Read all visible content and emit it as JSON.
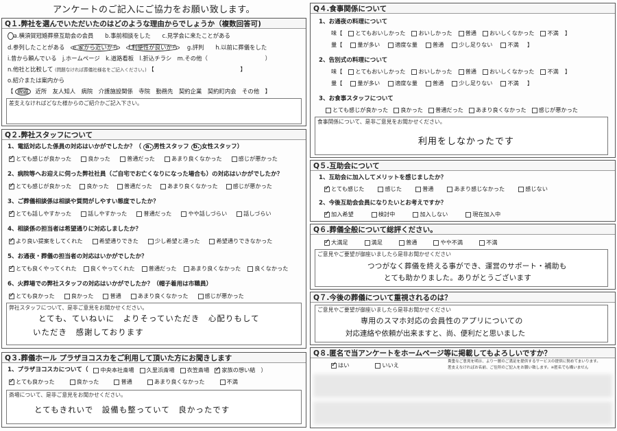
{
  "title": "アンケートのご記入にご協力をお願い致します。",
  "q1": {
    "head": "Q１.弊社を選んでいただいたのはどのような理由からでしょうか（複数回答可)",
    "row1": "a.横須賀冠婚葬祭互助会の会員　　b.事前相談をした　　c.見学会に来たことがある",
    "row2_a": "d.参列したことがある",
    "row2_e": "e.家から近いから",
    "row2_f": "f.利便性が良いから",
    "row2_rest": "g.評判　　h.以前に葬儀をした",
    "row3": "i.昔から頼んでいる　j.ホームページ　k.道路看板　l.折込チラシ　m.その他（　　　　　　　　　　）",
    "row4": "n.他社と比較して",
    "row4_small": "(問題なければ葬儀社様名をご記入ください。)",
    "row4_end": "【　　　　　　　　　　　　　　　】",
    "row5": "o.紹介または案内から",
    "row6_open": "【",
    "row6_circ": "親戚",
    "row6_rest": "近所　友人知人　病院　介護施設関係　寺院　勤務先　契約企業　契約町内会　その他　】",
    "box_label": "差支えなければどなた様からのご紹介かご記入下さい。"
  },
  "q2": {
    "head": "Q２.弊社スタッフについて",
    "sub1": "1、電話対応した係員の対応はいかがでしたか？（",
    "sub1_a": "a.",
    "sub1_a_text": "男性スタッフ",
    "sub1_b": "b.",
    "sub1_b_text": "女性スタッフ）",
    "opts1": [
      "とても感じが良かった",
      "良かった",
      "普通だった",
      "あまり良くなかった",
      "感じが悪かった"
    ],
    "sub2": "2、病院等へお迎えに伺った弊社社員（ご自宅でお亡くなりになった場合も）の対応はいかがでしたか？",
    "opts2": [
      "とても感じが良かった",
      "良かった",
      "普通だった",
      "あまり良くなかった",
      "感じが悪かった"
    ],
    "sub3": "3、ご葬儀相談係は相談や質問がしやすい態度でしたか？",
    "opts3": [
      "とても話しやすかった",
      "話しやすかった",
      "普通だった",
      "やや話しづらい",
      "話しづらい"
    ],
    "sub4": "4、相談係の担当者は希望通りに対応しましたか？",
    "opts4": [
      "より良い提案をしてくれた",
      "希望通りできた",
      "少し希望と違った",
      "希望通りできなかった"
    ],
    "sub5": "5、お通夜・葬儀の担当者の対応はいかがでしたか？",
    "opts5": [
      "とても良くやってくれた",
      "良くやってくれた",
      "普通だった",
      "あまり良くなかった",
      "良くなかった"
    ],
    "sub6": "6、火葬場での弊社スタッフの対応はいかがでしたか？（帽子着用は市職員）",
    "opts6": [
      "とても良かった",
      "良かった",
      "普通",
      "あまり良くなかった",
      "感じが悪かった"
    ],
    "box_label": "弊社スタッフについて、是非ご意見をお聞かせください。",
    "hw1": "とても、ていねいに　よりそっていただき　心配りもして",
    "hw2": "いただき　感謝しております"
  },
  "q3": {
    "head": "Q３.葬儀ホール プラザヨコスカをご利用して頂いた方にお聞きします",
    "sub1": "1、プラザヨコスカについて（",
    "halls": [
      "中央本社斎場",
      "久里浜斎場",
      "衣笠斎場",
      "家族の想い結"
    ],
    "hall_end": "）",
    "opts": [
      "とても良かった",
      "良かった",
      "普通",
      "あまり良くなかった",
      "不満"
    ],
    "box_label": "斎場について、是非ご意見をお聞かせください。",
    "hw": "とてもきれいで　設備も整っていて　良かったです"
  },
  "q4": {
    "head": "Q４.食事関係について",
    "sub1": "1、お通夜の料理について",
    "taste_label": "味【",
    "taste_opts": [
      "とてもおいしかった",
      "おいしかった",
      "普通",
      "おいしくなかった",
      "不満"
    ],
    "taste_end": "】",
    "qty_label": "量【",
    "qty_opts": [
      "量が多い",
      "適度な量",
      "普通",
      "少し足りない",
      "不満"
    ],
    "qty_end": "】",
    "sub2": "2、告別式の料理について",
    "sub3": "3、お食事スタッフについて",
    "staff_opts": [
      "とても感じが良かった",
      "良かった",
      "普通だった",
      "あまり良くなかった",
      "感じが悪かった"
    ],
    "box_label": "食事関係について、是非ご意見をお聞かせください。",
    "hw": "利用をしなかったです"
  },
  "q5": {
    "head": "Q５.互助会について",
    "sub1": "1、互助会に加入してメリットを感じましたか？",
    "opts1": [
      "とても感じた",
      "感じた",
      "普通",
      "あまり感じなかった",
      "感じない"
    ],
    "sub2": "2、今後互助会会員になりたいとお考えですか？",
    "opts2": [
      "加入希望",
      "検討中",
      "加入しない",
      "現在加入中"
    ]
  },
  "q6": {
    "head": "Q６.葬儀全般について総評ください。",
    "opts": [
      "大満足",
      "満足",
      "普通",
      "やや不満",
      "不満"
    ],
    "box_label": "ご意見やご要望が御座いましたら是非お聞かせください",
    "hw1": "つつがなく葬儀を終える事ができ、運営のサポート・補助も",
    "hw2": "とても助かりました。ありがとうございます"
  },
  "q7": {
    "head": "Q７.今後の葬儀について重視されるのは？",
    "box_label": "ご意見やご要望が御座いましたら是非お聞かせください",
    "hw1": "専用のスマホ対応の会員性のアプリについての",
    "hw2": "対応連絡や依頼が出来ますと、尚、便利だと思いました"
  },
  "q8": {
    "head": "Q８.匿名で当アンケートをホームページ等に掲載してもよろしいですか？",
    "opts": [
      "はい",
      "いいえ"
    ],
    "note1": "貴重なご意見を明示、より一層のご満足を提供するサービスの提供に努めてまいります。",
    "note2": "差支えなければお名前、ご住所のご記入をお願い致します。※匿名でも構いません"
  },
  "colors": {
    "ink": "#222222",
    "border": "#555555",
    "check": "#111111",
    "redacted": "#e8e8e8"
  },
  "checked": {
    "q1": [
      "a",
      "e",
      "f",
      "親戚"
    ],
    "q2": [
      0,
      0,
      0,
      0,
      0,
      0
    ],
    "q2_staff": [
      "a",
      "b"
    ],
    "q3_hall": 3,
    "q3_rating": 0,
    "q5_1": 0,
    "q5_2": 0,
    "q6": 0,
    "q8": 0
  }
}
